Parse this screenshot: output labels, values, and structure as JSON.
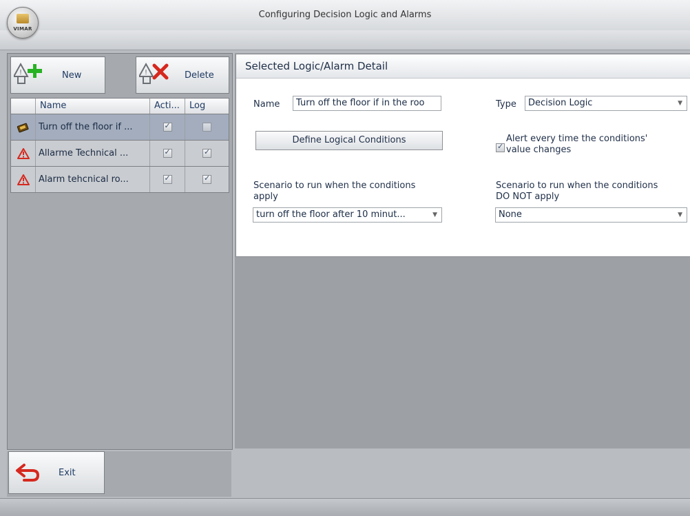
{
  "window": {
    "title": "Configuring Decision Logic and Alarms",
    "logo_text": "VIMAR"
  },
  "toolbar": {
    "new_label": "New",
    "delete_label": "Delete"
  },
  "grid": {
    "columns": [
      "Name",
      "Acti...",
      "Log"
    ],
    "rows": [
      {
        "icon": "decision-logic-icon",
        "name": "Turn off the floor if ...",
        "active": true,
        "log": false
      },
      {
        "icon": "alarm-warning-icon",
        "name": "Allarme Technical ...",
        "active": true,
        "log": true
      },
      {
        "icon": "alarm-warning-icon",
        "name": "Alarm tehcnical ro...",
        "active": true,
        "log": true
      }
    ]
  },
  "detail": {
    "header": "Selected Logic/Alarm Detail",
    "name_label": "Name",
    "name_value": "Turn off the floor if in the roo",
    "type_label": "Type",
    "type_value": "Decision Logic",
    "define_button": "Define Logical Conditions",
    "alert_checked": true,
    "alert_label_line1": "Alert every time the conditions'",
    "alert_label_line2": "value changes",
    "scenario_apply_label_line1": "Scenario to run when the conditions",
    "scenario_apply_label_line2": "apply",
    "scenario_apply_value": "turn off the floor after 10 minut...",
    "scenario_notapply_label_line1": "Scenario to run when the conditions",
    "scenario_notapply_label_line2": "DO NOT apply",
    "scenario_notapply_value": "None"
  },
  "footer": {
    "exit_label": "Exit"
  },
  "colors": {
    "accent_red": "#d6281e",
    "accent_green": "#27b223",
    "selected_row": "#a3adbe"
  }
}
